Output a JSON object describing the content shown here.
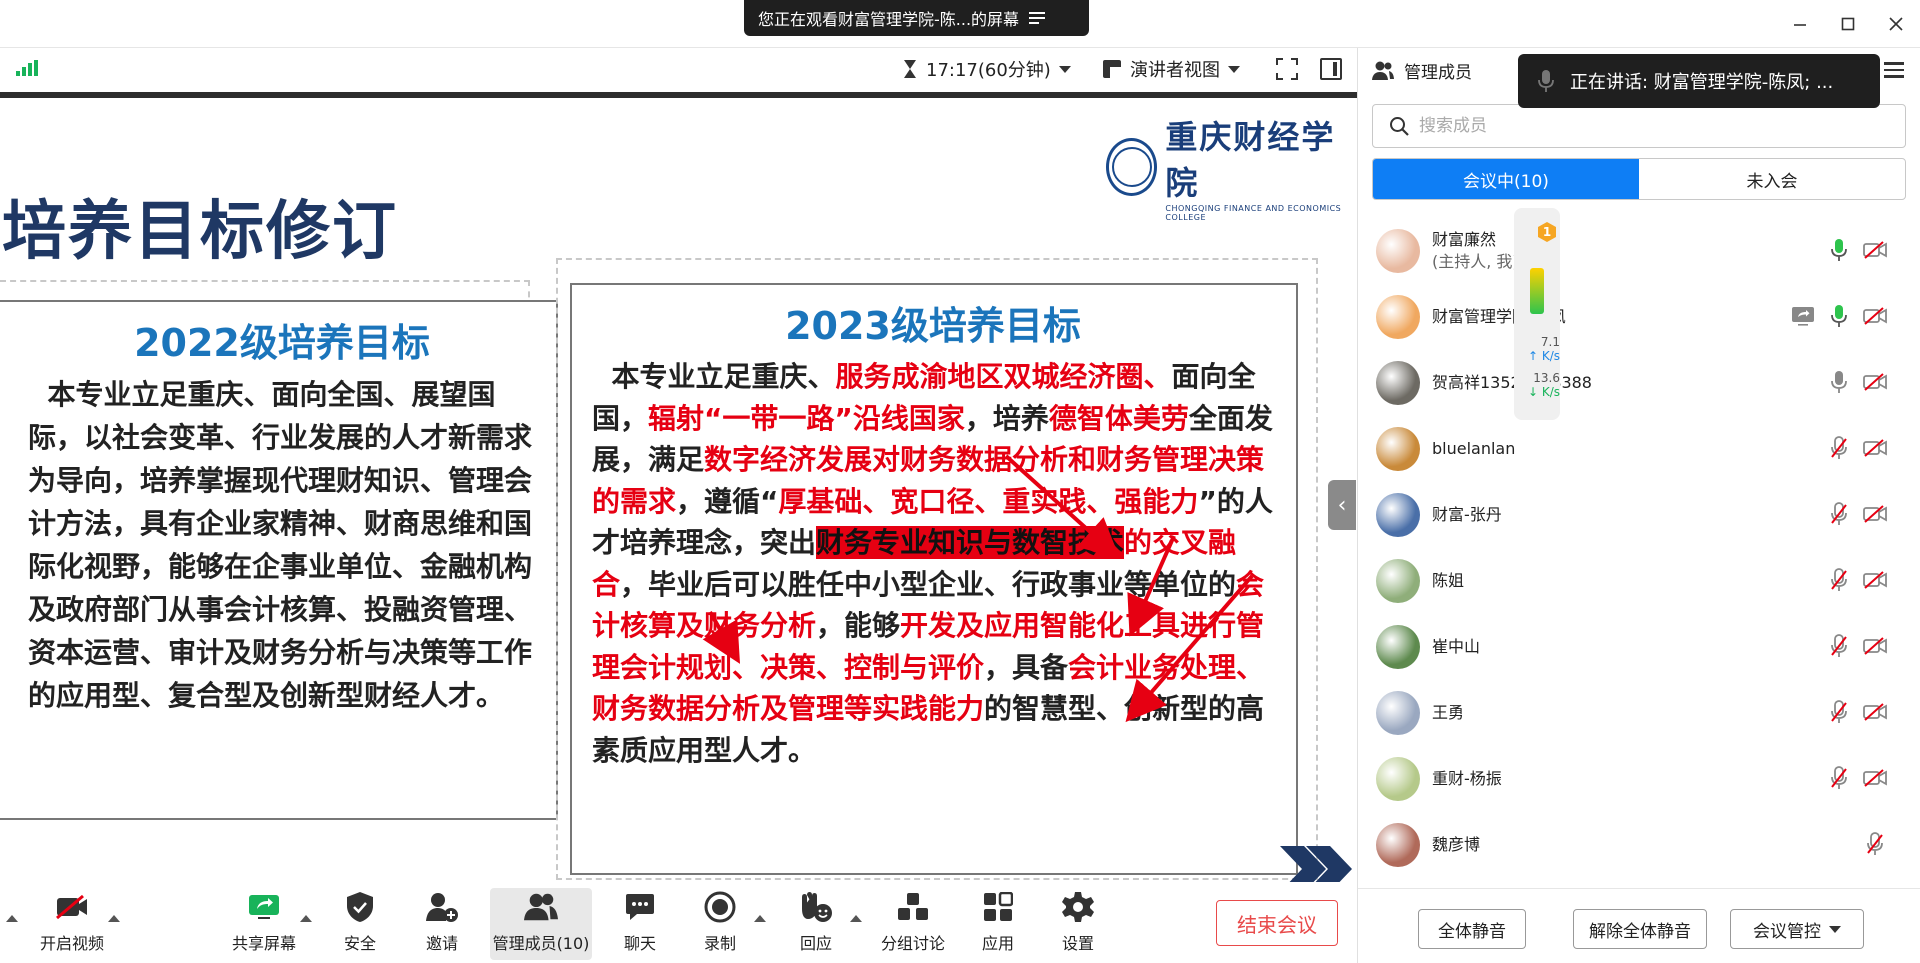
{
  "window": {
    "share_banner": "您正在观看财富管理学院-陈...的屏幕"
  },
  "topbar": {
    "timer": "17:17(60分钟)",
    "view_mode": "演讲者视图"
  },
  "slide": {
    "logo_cn": "重庆财经学院",
    "logo_en": "CHONGQING FINANCE AND ECONOMICS COLLEGE",
    "title": "培养目标修订",
    "left_box": {
      "heading": "2022级培养目标",
      "body": "本专业立足重庆、面向全国、展望国际，以社会变革、行业发展的人才新需求为导向，培养掌握现代理财知识、管理会计方法，具有企业家精神、财商思维和国际化视野，能够在企事业单位、金融机构及政府部门从事会计核算、投融资管理、资本运营、审计及财务分析与决策等工作的应用型、复合型及创新型财经人才。"
    },
    "right_box": {
      "heading": "2023级培养目标",
      "segments": [
        {
          "text": "本专业立足重庆、",
          "style": "normal"
        },
        {
          "text": "服务成渝地区双城经济圈、",
          "style": "red"
        },
        {
          "text": "面向全国，",
          "style": "normal"
        },
        {
          "text": "辐射“一带一路”沿线国家",
          "style": "red"
        },
        {
          "text": "，培养",
          "style": "normal"
        },
        {
          "text": "德智体美劳",
          "style": "red"
        },
        {
          "text": "全面发展，满足",
          "style": "normal"
        },
        {
          "text": "数字经济发展对财务数据分析和财务管理决策的需求",
          "style": "red"
        },
        {
          "text": "，遵循“",
          "style": "normal"
        },
        {
          "text": "厚基础、宽口径、重实践、强能力",
          "style": "red"
        },
        {
          "text": "”的人才培养理念，突出",
          "style": "normal"
        },
        {
          "text": "财务专业知识与数智技术",
          "style": "block"
        },
        {
          "text": "的交叉融合",
          "style": "red"
        },
        {
          "text": "，毕业后可以胜任中小型企业、行政事业等单位的",
          "style": "normal"
        },
        {
          "text": "会计核算及财务分析",
          "style": "red"
        },
        {
          "text": "，能够",
          "style": "normal"
        },
        {
          "text": "开发及应用智能化工具进行管理会计规划、决策、控制与评价",
          "style": "red"
        },
        {
          "text": "，具备",
          "style": "normal"
        },
        {
          "text": "会计业务处理、财务数据分析及管理等实践能力",
          "style": "red"
        },
        {
          "text": "的智慧型、创新型的高素质应用型人才。",
          "style": "normal"
        }
      ]
    }
  },
  "bottom_toolbar": {
    "video": "开启视频",
    "share": "共享屏幕",
    "security": "安全",
    "invite": "邀请",
    "members": "管理成员(10)",
    "chat": "聊天",
    "record": "录制",
    "reaction": "回应",
    "breakout": "分组讨论",
    "apps": "应用",
    "settings": "设置",
    "end_meeting": "结束会议"
  },
  "right_panel": {
    "title": "管理成员",
    "speaking_toast": "正在讲话:  财富管理学院-陈凤; ...",
    "search_placeholder": "搜索成员",
    "tabs": [
      "会议中(10)",
      "未入会"
    ],
    "upload_rate": "7.1",
    "download_rate": "13.6",
    "rate_unit": "K/s",
    "badge": "1",
    "members": [
      {
        "name": "财富廉然",
        "sub": "(主持人, 我)",
        "mic": "on",
        "share": false,
        "avatar_color": "#e8b9a0"
      },
      {
        "name": "财富管理学院-陈凤",
        "sub": "",
        "mic": "on",
        "share": true,
        "avatar_color": "#f0a860"
      },
      {
        "name": "贺高祥13527548388",
        "sub": "",
        "mic": "idle",
        "share": false,
        "avatar_color": "#6d6a63"
      },
      {
        "name": "bluelanlan",
        "sub": "",
        "mic": "muted",
        "share": false,
        "avatar_color": "#c98a3a"
      },
      {
        "name": "财富-张丹",
        "sub": "",
        "mic": "muted",
        "share": false,
        "avatar_color": "#4a6fa8"
      },
      {
        "name": "陈姐",
        "sub": "",
        "mic": "muted",
        "share": false,
        "avatar_color": "#8fae7a"
      },
      {
        "name": "崔中山",
        "sub": "",
        "mic": "muted",
        "share": false,
        "avatar_color": "#5e8a4e"
      },
      {
        "name": "王勇",
        "sub": "",
        "mic": "muted",
        "share": false,
        "avatar_color": "#9aa8c0"
      },
      {
        "name": "重财-杨振",
        "sub": "",
        "mic": "muted",
        "share": false,
        "avatar_color": "#b5c98a"
      },
      {
        "name": "魏彦博",
        "sub": "",
        "mic": "muted",
        "share": false,
        "avatar_color": "#b06a5a",
        "no_video_icon": true
      }
    ],
    "footer": {
      "mute_all": "全体静音",
      "unmute_all": "解除全体静音",
      "control": "会议管控"
    }
  }
}
